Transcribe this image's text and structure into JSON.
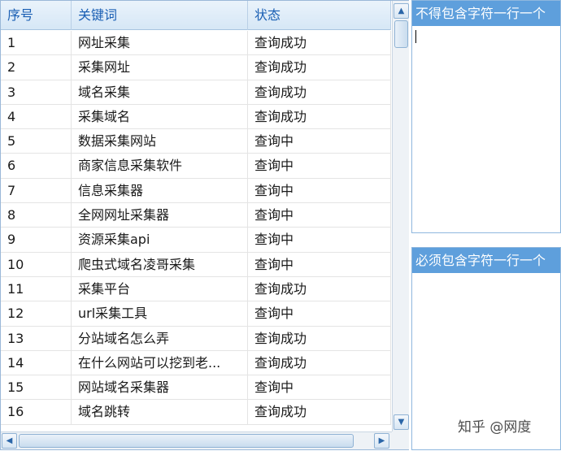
{
  "table": {
    "columns": [
      "序号",
      "关键词",
      "状态"
    ],
    "rows": [
      [
        "1",
        "网址采集",
        "查询成功"
      ],
      [
        "2",
        "采集网址",
        "查询成功"
      ],
      [
        "3",
        "域名采集",
        "查询成功"
      ],
      [
        "4",
        "采集域名",
        "查询成功"
      ],
      [
        "5",
        "数据采集网站",
        "查询中"
      ],
      [
        "6",
        "商家信息采集软件",
        "查询中"
      ],
      [
        "7",
        "信息采集器",
        "查询中"
      ],
      [
        "8",
        "全网网址采集器",
        "查询中"
      ],
      [
        "9",
        "资源采集api",
        "查询中"
      ],
      [
        "10",
        "爬虫式域名凌哥采集",
        "查询中"
      ],
      [
        "11",
        "采集平台",
        "查询成功"
      ],
      [
        "12",
        "url采集工具",
        "查询中"
      ],
      [
        "13",
        "分站域名怎么弄",
        "查询成功"
      ],
      [
        "14",
        "在什么网站可以挖到老...",
        "查询成功"
      ],
      [
        "15",
        "网站域名采集器",
        "查询中"
      ],
      [
        "16",
        "域名跳转",
        "查询成功"
      ]
    ]
  },
  "scrollbar": {
    "up_icon": "triangle-up-icon",
    "down_icon": "triangle-down-icon",
    "left_icon": "triangle-left-icon",
    "right_icon": "triangle-right-icon"
  },
  "panels": {
    "exclude": {
      "title": "不得包含字符一行一个",
      "value": ""
    },
    "include": {
      "title": "必须包含字符一行一个",
      "value": ""
    }
  },
  "watermark": "知乎 @网度",
  "colors": {
    "header_text": "#1a5fb4",
    "panel_title_bg": "#5e9fdc",
    "panel_title_text": "#ffffff"
  }
}
